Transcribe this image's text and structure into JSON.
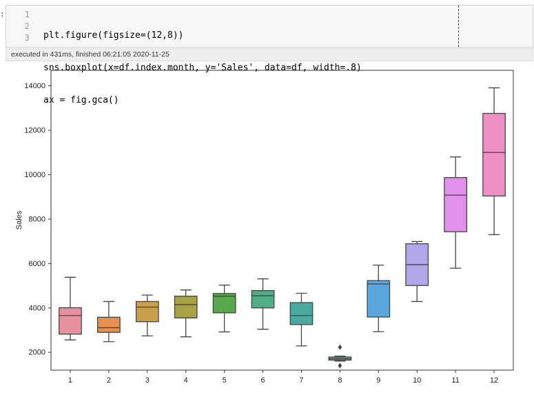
{
  "cell": {
    "prompt_marker": ":",
    "line_numbers": [
      "1",
      "2",
      "3"
    ],
    "code_lines": [
      "plt.figure(figsize=(12,8))",
      "sns.boxplot(x=df.index.month, y='Sales', data=df, width=.8)",
      "ax = fig.gca()"
    ],
    "execution_info": "executed in 431ms, finished 06:21:05 2020-11-25"
  },
  "chart_data": {
    "type": "box",
    "title": "",
    "xlabel": "",
    "ylabel": "Sales",
    "ylim": [
      1200,
      14700
    ],
    "yticks": [
      2000,
      4000,
      6000,
      8000,
      10000,
      12000,
      14000
    ],
    "categories": [
      "1",
      "2",
      "3",
      "4",
      "5",
      "6",
      "7",
      "8",
      "9",
      "10",
      "11",
      "12"
    ],
    "boxes": [
      {
        "category": "1",
        "whisker_low": 2560,
        "q1": 2820,
        "median": 3660,
        "q3": 4010,
        "whisker_high": 5380,
        "outliers": [],
        "color": "#e8919e"
      },
      {
        "category": "2",
        "whisker_low": 2480,
        "q1": 2900,
        "median": 3110,
        "q3": 3580,
        "whisker_high": 4290,
        "outliers": [],
        "color": "#e6904f"
      },
      {
        "category": "3",
        "whisker_low": 2740,
        "q1": 3380,
        "median": 4040,
        "q3": 4290,
        "whisker_high": 4580,
        "outliers": [],
        "color": "#c8a04c"
      },
      {
        "category": "4",
        "whisker_low": 2700,
        "q1": 3550,
        "median": 4150,
        "q3": 4530,
        "whisker_high": 4810,
        "outliers": [],
        "color": "#a7a243"
      },
      {
        "category": "5",
        "whisker_low": 2920,
        "q1": 3780,
        "median": 4530,
        "q3": 4650,
        "whisker_high": 5030,
        "outliers": [],
        "color": "#58a74e"
      },
      {
        "category": "6",
        "whisker_low": 3040,
        "q1": 4000,
        "median": 4550,
        "q3": 4780,
        "whisker_high": 5310,
        "outliers": [],
        "color": "#4fae85"
      },
      {
        "category": "7",
        "whisker_low": 2290,
        "q1": 3250,
        "median": 3660,
        "q3": 4240,
        "whisker_high": 4660,
        "outliers": [],
        "color": "#4aa99e"
      },
      {
        "category": "8",
        "whisker_low": 1610,
        "q1": 1650,
        "median": 1710,
        "q3": 1790,
        "whisker_high": 1830,
        "outliers": [
          1400,
          2230
        ],
        "color": "#49a8b2"
      },
      {
        "category": "9",
        "whisker_low": 2930,
        "q1": 3590,
        "median": 5080,
        "q3": 5230,
        "whisker_high": 5930,
        "outliers": [],
        "color": "#5ca6de"
      },
      {
        "category": "10",
        "whisker_low": 4290,
        "q1": 5010,
        "median": 5950,
        "q3": 6890,
        "whisker_high": 6990,
        "outliers": [],
        "color": "#b3a6ea"
      },
      {
        "category": "11",
        "whisker_low": 5790,
        "q1": 7430,
        "median": 9080,
        "q3": 9870,
        "whisker_high": 10800,
        "outliers": [],
        "color": "#e291ea"
      },
      {
        "category": "12",
        "whisker_low": 7300,
        "q1": 9040,
        "median": 11000,
        "q3": 12760,
        "whisker_high": 13910,
        "outliers": [],
        "color": "#ee8fc4"
      }
    ],
    "grid": false,
    "legend": "none"
  }
}
